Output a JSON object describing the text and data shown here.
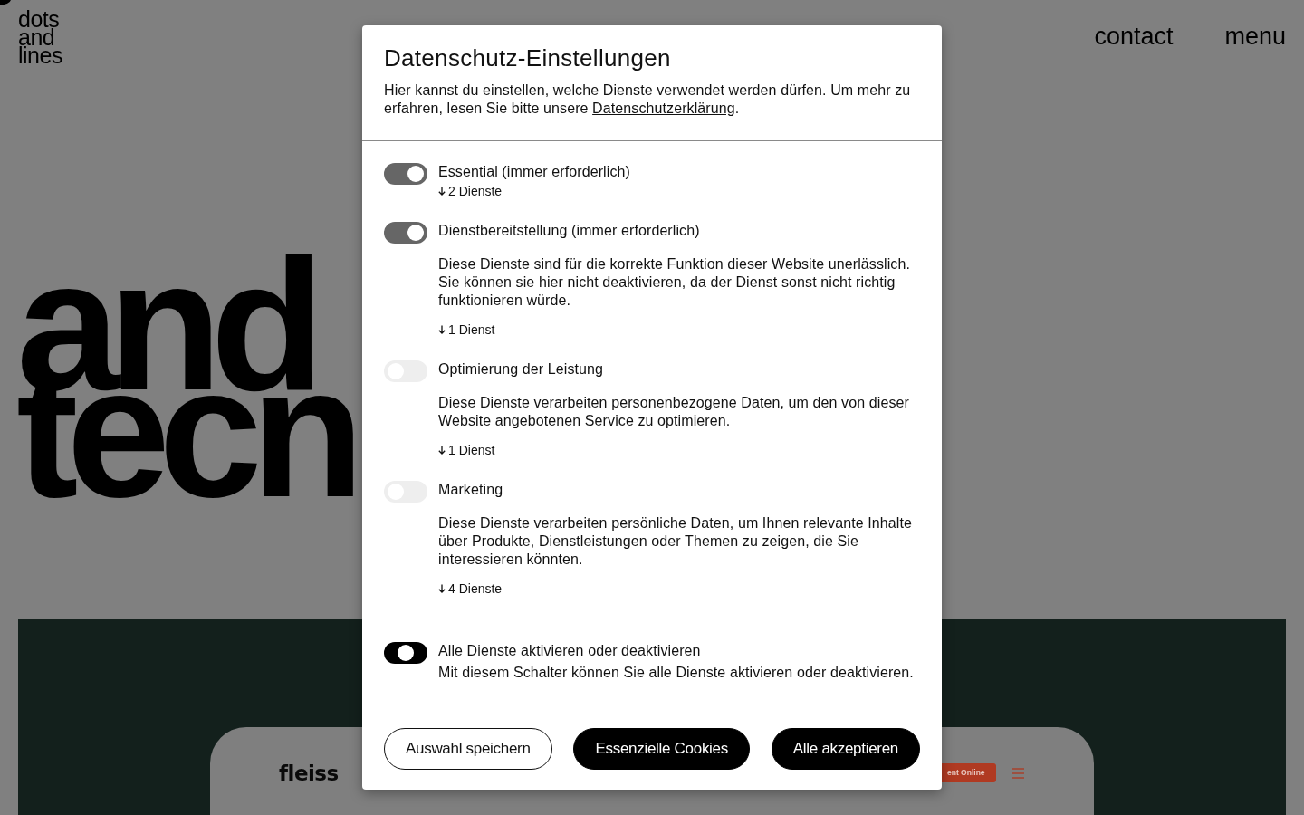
{
  "page": {
    "logo": [
      "dots",
      "and",
      "lines"
    ],
    "nav": [
      "contact",
      "menu"
    ],
    "hero_lines": [
      "and",
      "tecn"
    ],
    "showcase": {
      "brand": "fleiss",
      "cta": "ent Online"
    }
  },
  "consent_dialog": {
    "title": "Datenschutz-Einstellungen",
    "intro": "Hier kannst du einstellen, welche Dienste verwendet werden dürfen. Um mehr zu erfahren, lesen Sie bitte unsere ",
    "intro_link": "Datenschutzerklärung",
    "intro_end": ".",
    "categories": [
      {
        "title": "Essential (immer erforderlich)",
        "checked": true,
        "disabled": true,
        "services": "2 Dienste"
      },
      {
        "title": "Dienstbereitstellung (immer erforderlich)",
        "checked": true,
        "disabled": true,
        "description": "Diese Dienste sind für die korrekte Funktion dieser Website unerlässlich. Sie können sie hier nicht deaktivieren, da der Dienst sonst nicht richtig funktionieren würde.",
        "services": "1 Dienst"
      },
      {
        "title": "Optimierung der Leistung",
        "checked": false,
        "disabled": false,
        "description": "Diese Dienste verarbeiten personenbezogene Daten, um den von dieser Website angebotenen Service zu optimieren.",
        "services": "1 Dienst"
      },
      {
        "title": "Marketing",
        "checked": false,
        "disabled": false,
        "description": "Diese Dienste verarbeiten persönliche Daten, um Ihnen relevante Inhalte über Produkte, Dienstleistungen oder Themen zu zeigen, die Sie interessieren könnten.",
        "services": "4 Dienste"
      }
    ],
    "master": {
      "title": "Alle Dienste aktivieren oder deaktivieren",
      "description": "Mit diesem Schalter können Sie alle Dienste aktivieren oder deaktivieren.",
      "checked": true,
      "indeterminate": true
    },
    "buttons": [
      {
        "label": "Auswahl speichern",
        "kind": "outline"
      },
      {
        "label": "Essenzielle Cookies",
        "kind": "filled"
      },
      {
        "label": "Alle akzeptieren",
        "kind": "filled"
      }
    ]
  }
}
